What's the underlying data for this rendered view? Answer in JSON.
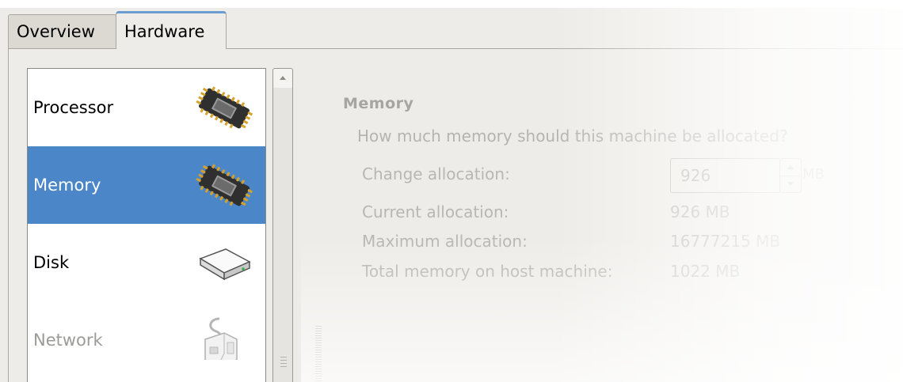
{
  "tabs": [
    {
      "label": "Overview",
      "selected": false
    },
    {
      "label": "Hardware",
      "selected": true
    }
  ],
  "hardware_list": [
    {
      "label": "Processor",
      "icon": "processor-chip-icon",
      "selected": false,
      "enabled": true
    },
    {
      "label": "Memory",
      "icon": "memory-chip-icon",
      "selected": true,
      "enabled": true
    },
    {
      "label": "Disk",
      "icon": "disk-drive-icon",
      "selected": false,
      "enabled": true
    },
    {
      "label": "Network",
      "icon": "network-cable-icon",
      "selected": false,
      "enabled": false
    }
  ],
  "memory": {
    "title": "Memory",
    "question": "How much memory should this machine be allocated?",
    "change_label": "Change allocation:",
    "change_value": "926",
    "change_unit": "MB",
    "current_label": "Current allocation:",
    "current_value": "926 MB",
    "max_label": "Maximum allocation:",
    "max_value": "16777215 MB",
    "total_label": "Total memory on host machine:",
    "total_value": "1022 MB"
  },
  "colors": {
    "selection": "#4a86c8",
    "tab_accent": "#6a9ccf",
    "window_bg": "#eeece8"
  }
}
